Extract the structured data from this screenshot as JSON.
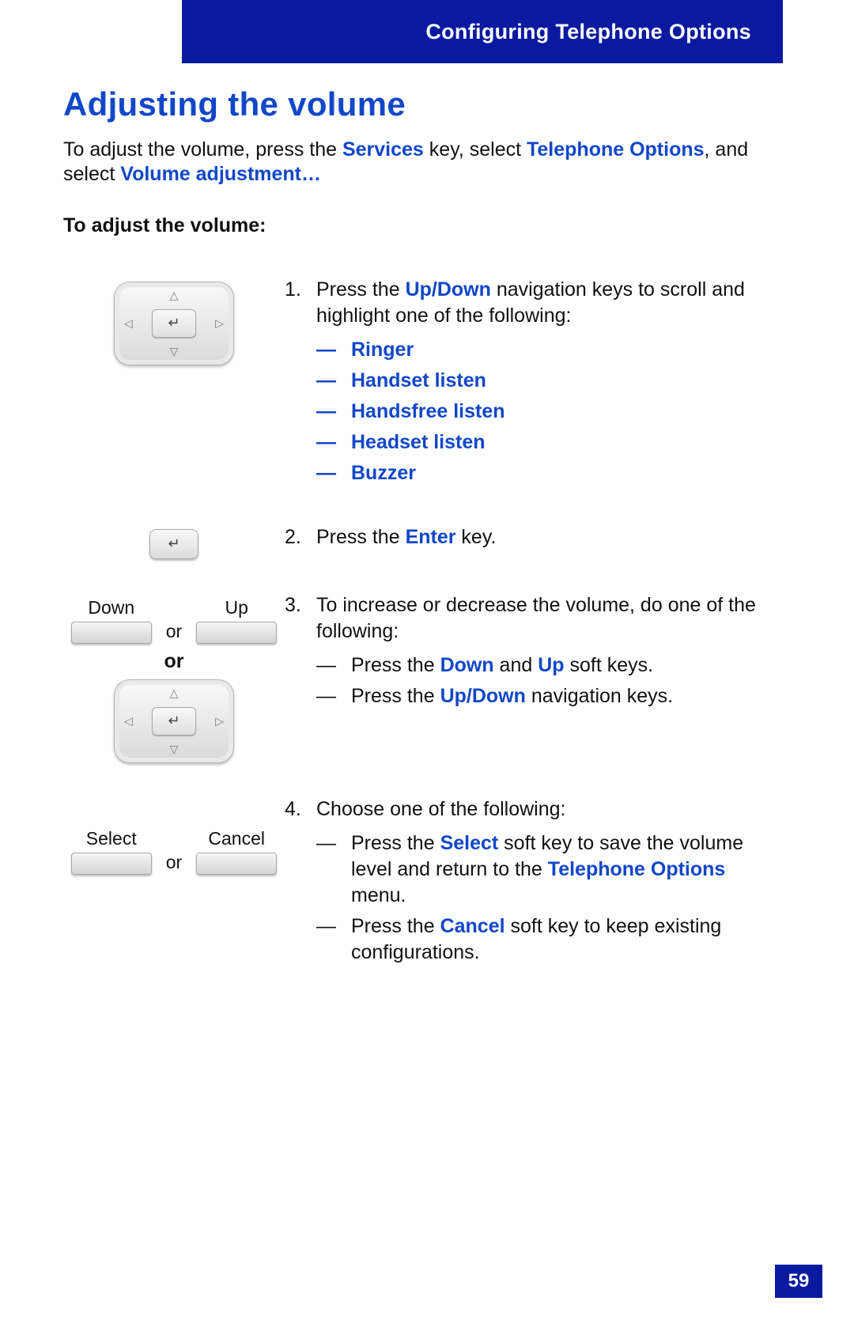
{
  "header": {
    "title": "Configuring Telephone Options"
  },
  "page_number": "59",
  "title": "Adjusting the volume",
  "intro": {
    "p1a": "To adjust the volume, press the ",
    "services": "Services",
    "p1b": " key, select ",
    "telopts": "Telephone Options",
    "p1c": ", and select ",
    "voladj": "Volume adjustment…"
  },
  "subhead": "To adjust the volume:",
  "steps": {
    "s1": {
      "num": "1.",
      "pre": "Press the ",
      "updown": "Up/Down",
      "post": " navigation keys to scroll and highlight one of the following:",
      "items": [
        "Ringer",
        "Handset listen",
        "Handsfree listen",
        "Headset listen",
        "Buzzer"
      ]
    },
    "s2": {
      "num": "2.",
      "pre": "Press the ",
      "enter": "Enter",
      "post": " key."
    },
    "s3": {
      "num": "3.",
      "lead": "To increase or decrease the volume, do one of the following:",
      "a_pre": "Press the ",
      "a_down": "Down",
      "a_and": " and ",
      "a_up": "Up",
      "a_post": " soft keys.",
      "b_pre": "Press the ",
      "b_updown": "Up/Down",
      "b_post": " navigation keys.",
      "soft_down": "Down",
      "soft_up": "Up",
      "or_small": "or",
      "or_bold": "or"
    },
    "s4": {
      "num": "4.",
      "lead": "Choose one of the following:",
      "a_pre": "Press the ",
      "a_sel": "Select",
      "a_mid": " soft key to save the volume level and return to the ",
      "a_to": "Telephone Options",
      "a_post": " menu.",
      "b_pre": "Press the ",
      "b_cancel": "Cancel",
      "b_post": " soft key to keep existing configurations.",
      "soft_select": "Select",
      "soft_cancel": "Cancel",
      "or_small": "or"
    }
  }
}
